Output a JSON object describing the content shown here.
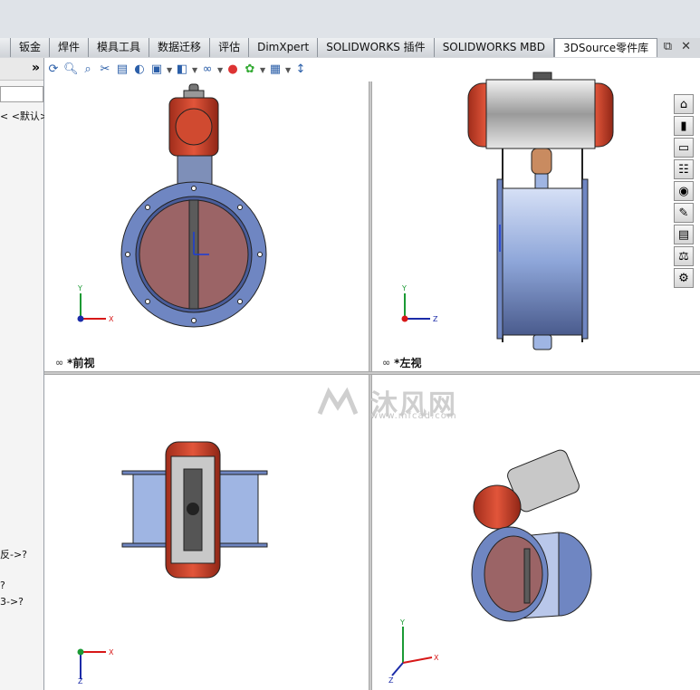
{
  "tabs": [
    "",
    "钣金",
    "焊件",
    "模具工具",
    "数据迁移",
    "评估",
    "DimXpert",
    "SOLIDWORKS 插件",
    "SOLIDWORKS MBD",
    "3DSource零件库"
  ],
  "window_controls": [
    "⧉",
    "✕"
  ],
  "left_panel": {
    "expand": "»",
    "config_text": "< <默认>_",
    "items": [
      "反->?",
      "?",
      "3->?"
    ]
  },
  "view_toolbar": {
    "icons": [
      "zoom-to-fit-icon",
      "zoom-area-icon",
      "zoom-selection-icon",
      "section-view-icon",
      "view-orientation-icon",
      "display-style-icon",
      "hide-show-icon",
      "edit-appearance-icon",
      "apply-scene-icon",
      "view-settings-icon",
      "rotate-icon"
    ]
  },
  "views": {
    "front_label": "*前视",
    "left_label": "*左视"
  },
  "triads": {
    "front": {
      "y": "Y",
      "x": "X"
    },
    "left": {
      "y": "Y",
      "z": "Z"
    },
    "top": {
      "x": "X",
      "z": "Z"
    },
    "iso": {
      "y": "Y",
      "x": "X",
      "z": "Z"
    }
  },
  "watermark": {
    "main": "沐风网",
    "sub": "www.mfcad.com"
  },
  "right_toolbar": [
    "home-icon",
    "resources-icon",
    "folder-icon",
    "library-icon",
    "appearance-icon",
    "properties-icon",
    "custom-icon",
    "design-check-icon",
    "toolbox-icon"
  ],
  "colors": {
    "actuator_red": "#d9442c",
    "disc": "#9b6466",
    "flange_blue": "#6f86c2",
    "body_blue": "#9fb5e3"
  }
}
